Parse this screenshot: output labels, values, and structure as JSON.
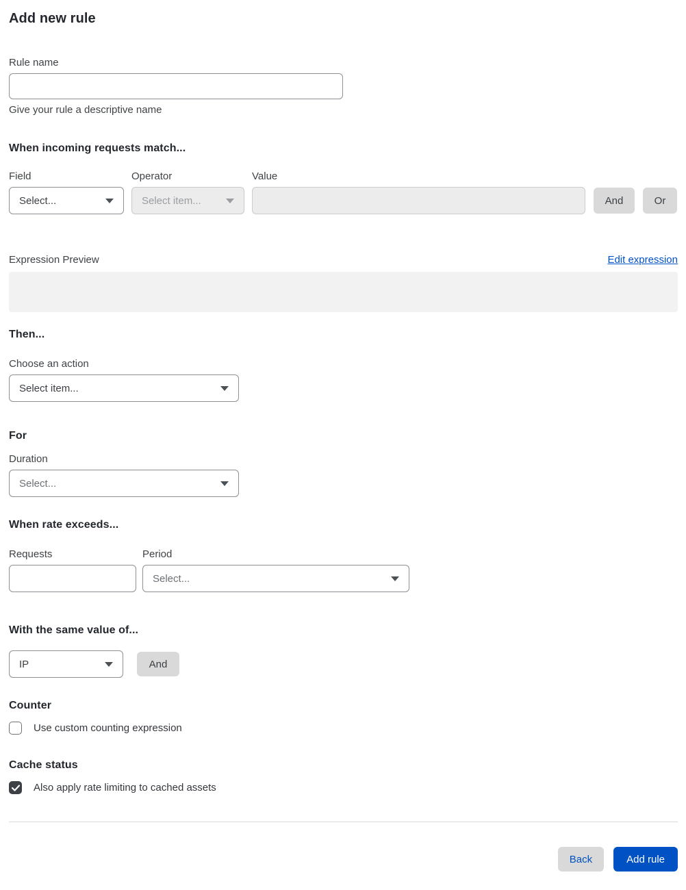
{
  "page": {
    "title": "Add new rule"
  },
  "rule_name": {
    "label": "Rule name",
    "value": "",
    "help": "Give your rule a descriptive name"
  },
  "match": {
    "heading": "When incoming requests match...",
    "field": {
      "label": "Field",
      "selected": "Select..."
    },
    "operator": {
      "label": "Operator",
      "selected": "Select item...",
      "disabled": true
    },
    "value": {
      "label": "Value",
      "value": "",
      "disabled": true
    },
    "and_button": "And",
    "or_button": "Or"
  },
  "expression": {
    "label": "Expression Preview",
    "edit_link": "Edit expression",
    "content": ""
  },
  "then": {
    "heading": "Then...",
    "action_label": "Choose an action",
    "action_selected": "Select item..."
  },
  "for": {
    "heading": "For",
    "duration_label": "Duration",
    "duration_selected": "Select..."
  },
  "rate": {
    "heading": "When rate exceeds...",
    "requests_label": "Requests",
    "requests_value": "",
    "period_label": "Period",
    "period_selected": "Select..."
  },
  "same_value": {
    "heading": "With the same value of...",
    "characteristic_selected": "IP",
    "and_button": "And"
  },
  "counter": {
    "heading": "Counter",
    "checkbox_label": "Use custom counting expression",
    "checked": false
  },
  "cache": {
    "heading": "Cache status",
    "checkbox_label": "Also apply rate limiting to cached assets",
    "checked": true
  },
  "footer": {
    "back_button": "Back",
    "submit_button": "Add rule"
  },
  "colors": {
    "accent_blue": "#0051c3",
    "disabled_bg": "#ececec",
    "preview_bg": "#f2f2f2",
    "button_gray": "#d9d9d9",
    "checkbox_checked": "#3d4045"
  }
}
